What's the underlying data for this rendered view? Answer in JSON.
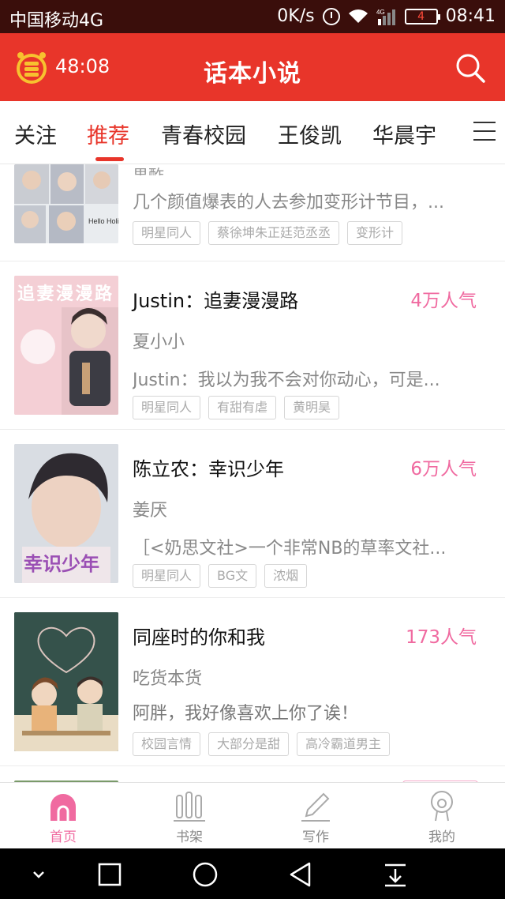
{
  "status_bar": {
    "carrier": "中国移动4G",
    "speed": "0K/s",
    "network": "4G",
    "battery": "4",
    "time": "08:41"
  },
  "header": {
    "timer": "48:08",
    "title": "话本小说",
    "coin_icon": "coin-stack-icon",
    "search_icon": "search-icon"
  },
  "tabs": [
    {
      "label": "关注"
    },
    {
      "label": "推荐"
    },
    {
      "label": "青春校园"
    },
    {
      "label": "王俊凯"
    },
    {
      "label": "华晨宇"
    }
  ],
  "active_tab": "推荐",
  "books": [
    {
      "title": "",
      "author": "果酢",
      "popularity": "",
      "desc": "几个颜值爆表的人去参加变形计节目，...",
      "tags": [
        "明星同人",
        "蔡徐坤朱正廷范丞丞",
        "变形计"
      ],
      "cover_text": "Hello Holiday!"
    },
    {
      "title": "Justin：追妻漫漫路",
      "author": "夏小小",
      "popularity": "4万人气",
      "desc": "Justin：我以为我不会对你动心，可是...",
      "tags": [
        "明星同人",
        "有甜有虐",
        "黄明昊"
      ],
      "cover_text": "追妻漫漫路"
    },
    {
      "title": "陈立农：幸识少年",
      "author": "姜厌",
      "popularity": "6万人气",
      "desc": "［<奶思文社>一个非常NB的草率文社...",
      "tags": [
        "明星同人",
        "BG文",
        "浓烟"
      ],
      "cover_text": "幸识少年"
    },
    {
      "title": "同座时的你和我",
      "author": "吃货本货",
      "popularity": "173人气",
      "desc": "阿胖，我好像喜欢上你了诶！",
      "tags": [
        "校园言情",
        "大部分是甜",
        "高冷霸道男主"
      ],
      "cover_text": ""
    }
  ],
  "bottom_nav": [
    {
      "label": "首页",
      "icon": "home-icon"
    },
    {
      "label": "书架",
      "icon": "bookshelf-icon"
    },
    {
      "label": "写作",
      "icon": "pencil-icon"
    },
    {
      "label": "我的",
      "icon": "profile-icon"
    }
  ],
  "colors": {
    "accent": "#e8352a",
    "popularity": "#f06aa0",
    "statusbar": "#3a0e0b"
  }
}
